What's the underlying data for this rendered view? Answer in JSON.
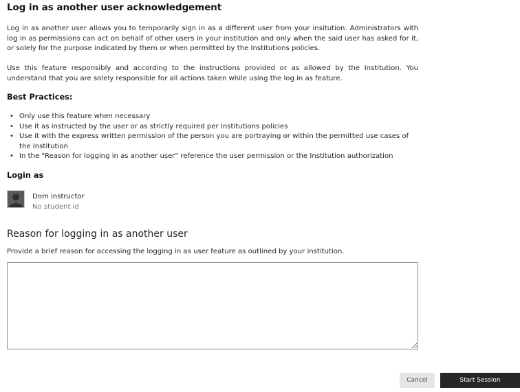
{
  "title": "Log in as another user acknowledgement",
  "paragraphs": [
    "Log in as another user allows you to temporarily sign in as a different user from your insitution. Administrators with log in as permissions can act on behalf of other users in your institution and only when the said user has asked for it, or solely for the purpose indicated by them or when permitted by the Institutions policies.",
    "Use this feature responsibly and according to the instructions provided or as allowed by the Institution. You understand that you are solely responsible for all actions taken while using the log in as feature."
  ],
  "best_practices": {
    "heading": "Best Practices:",
    "items": [
      "Only use this feature when necessary",
      "Use it as instructed by the user or as strictly required per Institutions policies",
      "Use it with the express written permission of the person you are portraying or within the permitted use cases of the Institution",
      "In the \"Reason for logging in as another user\" reference the user permission or the Institution authorization"
    ]
  },
  "login_as": {
    "heading": "Login as",
    "user_name": "Dom instructor",
    "student_id": "No student id"
  },
  "reason": {
    "heading": "Reason for logging in as another user",
    "help": "Provide a brief reason for accessing the logging in as user feature as outlined by your institution.",
    "value": ""
  },
  "buttons": {
    "cancel": "Cancel",
    "start": "Start Session"
  },
  "colors": {
    "primary_button": "#262626",
    "secondary_button": "#e5e5e5"
  }
}
